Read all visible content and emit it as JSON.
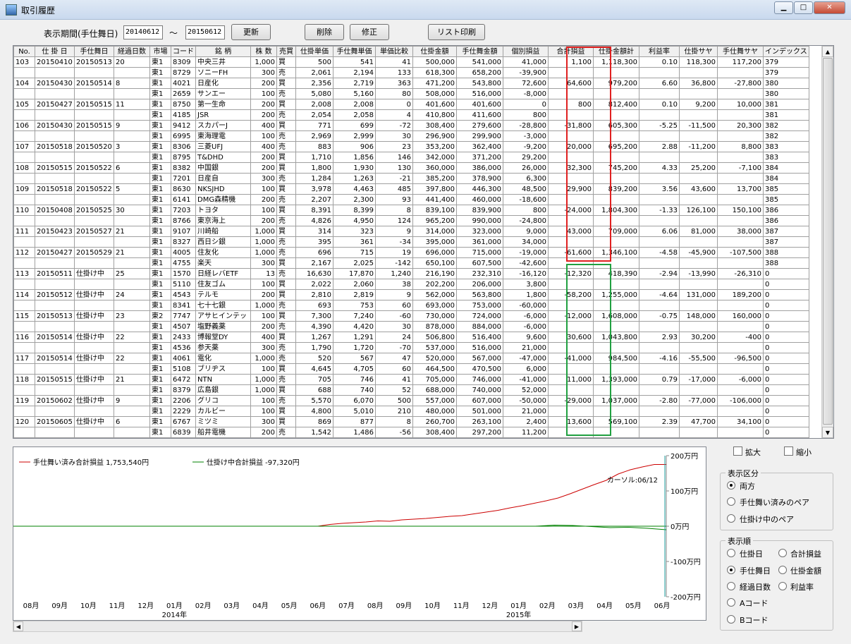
{
  "window": {
    "title": "取引履歴"
  },
  "toolbar": {
    "period_label": "表示期間(手仕舞日)",
    "date_from": "20140612",
    "tilde": "～",
    "date_to": "20150612",
    "refresh": "更新",
    "delete": "削除",
    "edit": "修正",
    "print": "リスト印刷"
  },
  "table": {
    "headers": [
      "No.",
      "仕 掛 日",
      "手仕舞日",
      "経過日数",
      "市場",
      "コード",
      "銘 柄",
      "株 数",
      "売買",
      "仕掛単価",
      "手仕舞単価",
      "単価比較",
      "仕掛金額",
      "手仕舞金額",
      "個別損益",
      "合計損益",
      "仕掛金額計",
      "利益率",
      "仕掛サヤ",
      "手仕舞サヤ",
      "インデックス"
    ],
    "rows": [
      [
        "103",
        "20150410",
        "20150513",
        "20",
        "東1",
        "8309",
        "中央三井",
        "1,000",
        "買",
        "500",
        "541",
        "41",
        "500,000",
        "541,000",
        "41,000",
        "1,100",
        "1,118,300",
        "0.10",
        "118,300",
        "117,200",
        "379"
      ],
      [
        "",
        "",
        "",
        "",
        "東1",
        "8729",
        "ソニーFH",
        "300",
        "売",
        "2,061",
        "2,194",
        "133",
        "618,300",
        "658,200",
        "-39,900",
        "",
        "",
        "",
        "",
        "",
        "379"
      ],
      [
        "104",
        "20150430",
        "20150514",
        "8",
        "東1",
        "4021",
        "日産化",
        "200",
        "買",
        "2,356",
        "2,719",
        "363",
        "471,200",
        "543,800",
        "72,600",
        "64,600",
        "979,200",
        "6.60",
        "36,800",
        "-27,800",
        "380"
      ],
      [
        "",
        "",
        "",
        "",
        "東1",
        "2659",
        "サンエー",
        "100",
        "売",
        "5,080",
        "5,160",
        "80",
        "508,000",
        "516,000",
        "-8,000",
        "",
        "",
        "",
        "",
        "",
        "380"
      ],
      [
        "105",
        "20150427",
        "20150515",
        "11",
        "東1",
        "8750",
        "第一生命",
        "200",
        "買",
        "2,008",
        "2,008",
        "0",
        "401,600",
        "401,600",
        "0",
        "800",
        "812,400",
        "0.10",
        "9,200",
        "10,000",
        "381"
      ],
      [
        "",
        "",
        "",
        "",
        "東1",
        "4185",
        "JSR",
        "200",
        "売",
        "2,054",
        "2,058",
        "4",
        "410,800",
        "411,600",
        "800",
        "",
        "",
        "",
        "",
        "",
        "381"
      ],
      [
        "106",
        "20150430",
        "20150515",
        "9",
        "東1",
        "9412",
        "スカパーJ",
        "400",
        "買",
        "771",
        "699",
        "-72",
        "308,400",
        "279,600",
        "-28,800",
        "-31,800",
        "605,300",
        "-5.25",
        "-11,500",
        "20,300",
        "382"
      ],
      [
        "",
        "",
        "",
        "",
        "東1",
        "6995",
        "東海理電",
        "100",
        "売",
        "2,969",
        "2,999",
        "30",
        "296,900",
        "299,900",
        "-3,000",
        "",
        "",
        "",
        "",
        "",
        "382"
      ],
      [
        "107",
        "20150518",
        "20150520",
        "3",
        "東1",
        "8306",
        "三菱UFJ",
        "400",
        "売",
        "883",
        "906",
        "23",
        "353,200",
        "362,400",
        "-9,200",
        "20,000",
        "695,200",
        "2.88",
        "-11,200",
        "8,800",
        "383"
      ],
      [
        "",
        "",
        "",
        "",
        "東1",
        "8795",
        "T&DHD",
        "200",
        "買",
        "1,710",
        "1,856",
        "146",
        "342,000",
        "371,200",
        "29,200",
        "",
        "",
        "",
        "",
        "",
        "383"
      ],
      [
        "108",
        "20150515",
        "20150522",
        "6",
        "東1",
        "8382",
        "中国銀",
        "200",
        "買",
        "1,800",
        "1,930",
        "130",
        "360,000",
        "386,000",
        "26,000",
        "32,300",
        "745,200",
        "4.33",
        "25,200",
        "-7,100",
        "384"
      ],
      [
        "",
        "",
        "",
        "",
        "東1",
        "7201",
        "日産自",
        "300",
        "売",
        "1,284",
        "1,263",
        "-21",
        "385,200",
        "378,900",
        "6,300",
        "",
        "",
        "",
        "",
        "",
        "384"
      ],
      [
        "109",
        "20150518",
        "20150522",
        "5",
        "東1",
        "8630",
        "NKSJHD",
        "100",
        "買",
        "3,978",
        "4,463",
        "485",
        "397,800",
        "446,300",
        "48,500",
        "29,900",
        "839,200",
        "3.56",
        "43,600",
        "13,700",
        "385"
      ],
      [
        "",
        "",
        "",
        "",
        "東1",
        "6141",
        "DMG森精機",
        "200",
        "売",
        "2,207",
        "2,300",
        "93",
        "441,400",
        "460,000",
        "-18,600",
        "",
        "",
        "",
        "",
        "",
        "385"
      ],
      [
        "110",
        "20150408",
        "20150525",
        "30",
        "東1",
        "7203",
        "トヨタ",
        "100",
        "買",
        "8,391",
        "8,399",
        "8",
        "839,100",
        "839,900",
        "800",
        "-24,000",
        "1,804,300",
        "-1.33",
        "126,100",
        "150,100",
        "386"
      ],
      [
        "",
        "",
        "",
        "",
        "東1",
        "8766",
        "東京海上",
        "200",
        "売",
        "4,826",
        "4,950",
        "124",
        "965,200",
        "990,000",
        "-24,800",
        "",
        "",
        "",
        "",
        "",
        "386"
      ],
      [
        "111",
        "20150423",
        "20150527",
        "21",
        "東1",
        "9107",
        "川崎船",
        "1,000",
        "買",
        "314",
        "323",
        "9",
        "314,000",
        "323,000",
        "9,000",
        "43,000",
        "709,000",
        "6.06",
        "81,000",
        "38,000",
        "387"
      ],
      [
        "",
        "",
        "",
        "",
        "東1",
        "8327",
        "西日シ銀",
        "1,000",
        "売",
        "395",
        "361",
        "-34",
        "395,000",
        "361,000",
        "34,000",
        "",
        "",
        "",
        "",
        "",
        "387"
      ],
      [
        "112",
        "20150427",
        "20150529",
        "21",
        "東1",
        "4005",
        "住友化",
        "1,000",
        "売",
        "696",
        "715",
        "19",
        "696,000",
        "715,000",
        "-19,000",
        "-61,600",
        "1,346,100",
        "-4.58",
        "-45,900",
        "-107,500",
        "388"
      ],
      [
        "",
        "",
        "",
        "",
        "東1",
        "4755",
        "楽天",
        "300",
        "買",
        "2,167",
        "2,025",
        "-142",
        "650,100",
        "607,500",
        "-42,600",
        "",
        "",
        "",
        "",
        "",
        "388"
      ],
      [
        "113",
        "20150511",
        "仕掛け中",
        "25",
        "東1",
        "1570",
        "日経レバETF",
        "13",
        "売",
        "16,630",
        "17,870",
        "1,240",
        "216,190",
        "232,310",
        "-16,120",
        "-12,320",
        "418,390",
        "-2.94",
        "-13,990",
        "-26,310",
        "0"
      ],
      [
        "",
        "",
        "",
        "",
        "東1",
        "5110",
        "住友ゴム",
        "100",
        "買",
        "2,022",
        "2,060",
        "38",
        "202,200",
        "206,000",
        "3,800",
        "",
        "",
        "",
        "",
        "",
        "0"
      ],
      [
        "114",
        "20150512",
        "仕掛け中",
        "24",
        "東1",
        "4543",
        "テルモ",
        "200",
        "買",
        "2,810",
        "2,819",
        "9",
        "562,000",
        "563,800",
        "1,800",
        "-58,200",
        "1,255,000",
        "-4.64",
        "131,000",
        "189,200",
        "0"
      ],
      [
        "",
        "",
        "",
        "",
        "東1",
        "8341",
        "七十七銀",
        "1,000",
        "売",
        "693",
        "753",
        "60",
        "693,000",
        "753,000",
        "-60,000",
        "",
        "",
        "",
        "",
        "",
        "0"
      ],
      [
        "115",
        "20150513",
        "仕掛け中",
        "23",
        "東2",
        "7747",
        "アサヒインテッ",
        "100",
        "買",
        "7,300",
        "7,240",
        "-60",
        "730,000",
        "724,000",
        "-6,000",
        "-12,000",
        "1,608,000",
        "-0.75",
        "148,000",
        "160,000",
        "0"
      ],
      [
        "",
        "",
        "",
        "",
        "東1",
        "4507",
        "塩野義薬",
        "200",
        "売",
        "4,390",
        "4,420",
        "30",
        "878,000",
        "884,000",
        "-6,000",
        "",
        "",
        "",
        "",
        "",
        "0"
      ],
      [
        "116",
        "20150514",
        "仕掛け中",
        "22",
        "東1",
        "2433",
        "博報堂DY",
        "400",
        "買",
        "1,267",
        "1,291",
        "24",
        "506,800",
        "516,400",
        "9,600",
        "30,600",
        "1,043,800",
        "2.93",
        "30,200",
        "-400",
        "0"
      ],
      [
        "",
        "",
        "",
        "",
        "東1",
        "4536",
        "参天薬",
        "300",
        "売",
        "1,790",
        "1,720",
        "-70",
        "537,000",
        "516,000",
        "21,000",
        "",
        "",
        "",
        "",
        "",
        "0"
      ],
      [
        "117",
        "20150514",
        "仕掛け中",
        "22",
        "東1",
        "4061",
        "電化",
        "1,000",
        "売",
        "520",
        "567",
        "47",
        "520,000",
        "567,000",
        "-47,000",
        "-41,000",
        "984,500",
        "-4.16",
        "-55,500",
        "-96,500",
        "0"
      ],
      [
        "",
        "",
        "",
        "",
        "東1",
        "5108",
        "ブリヂス",
        "100",
        "買",
        "4,645",
        "4,705",
        "60",
        "464,500",
        "470,500",
        "6,000",
        "",
        "",
        "",
        "",
        "",
        "0"
      ],
      [
        "118",
        "20150515",
        "仕掛け中",
        "21",
        "東1",
        "6472",
        "NTN",
        "1,000",
        "売",
        "705",
        "746",
        "41",
        "705,000",
        "746,000",
        "-41,000",
        "11,000",
        "1,393,000",
        "0.79",
        "-17,000",
        "-6,000",
        "0"
      ],
      [
        "",
        "",
        "",
        "",
        "東1",
        "8379",
        "広島銀",
        "1,000",
        "買",
        "688",
        "740",
        "52",
        "688,000",
        "740,000",
        "52,000",
        "",
        "",
        "",
        "",
        "",
        "0"
      ],
      [
        "119",
        "20150602",
        "仕掛け中",
        "9",
        "東1",
        "2206",
        "グリコ",
        "100",
        "売",
        "5,570",
        "6,070",
        "500",
        "557,000",
        "607,000",
        "-50,000",
        "-29,000",
        "1,037,000",
        "-2.80",
        "-77,000",
        "-106,000",
        "0"
      ],
      [
        "",
        "",
        "",
        "",
        "東1",
        "2229",
        "カルビー",
        "100",
        "買",
        "4,800",
        "5,010",
        "210",
        "480,000",
        "501,000",
        "21,000",
        "",
        "",
        "",
        "",
        "",
        "0"
      ],
      [
        "120",
        "20150605",
        "仕掛け中",
        "6",
        "東1",
        "6767",
        "ミツミ",
        "300",
        "買",
        "869",
        "877",
        "8",
        "260,700",
        "263,100",
        "2,400",
        "13,600",
        "569,100",
        "2.39",
        "47,700",
        "34,100",
        "0"
      ],
      [
        "",
        "",
        "",
        "",
        "東1",
        "6839",
        "船井電機",
        "200",
        "売",
        "1,542",
        "1,486",
        "-56",
        "308,400",
        "297,200",
        "11,200",
        "",
        "",
        "",
        "",
        "",
        "0"
      ]
    ]
  },
  "chart_data": {
    "type": "line",
    "legend": [
      "手仕舞い済み合計損益 1,753,540円",
      "仕掛け中合計損益 -97,320円"
    ],
    "colors": [
      "#cc0000",
      "#008000"
    ],
    "y_ticks": [
      "200万円",
      "100万円",
      "0万円",
      "-100万円",
      "-200万円"
    ],
    "ylim": [
      -200,
      200
    ],
    "x_ticks": [
      "08月",
      "09月",
      "10月",
      "11月",
      "12月",
      "01月",
      "02月",
      "03月",
      "04月",
      "05月",
      "06月",
      "07月",
      "08月",
      "09月",
      "10月",
      "11月",
      "12月",
      "01月",
      "02月",
      "03月",
      "04月",
      "05月",
      "06月"
    ],
    "year_labels": [
      "2014年",
      "2015年"
    ],
    "cursor_label": "カーソル:06/12",
    "series": [
      {
        "name": "手仕舞い済み合計損益 1,753,540円",
        "start_index": 10,
        "values": [
          0,
          5,
          8,
          10,
          12,
          15,
          14,
          18,
          20,
          22,
          25,
          28,
          30,
          35,
          40,
          45,
          52,
          58,
          65,
          72,
          80,
          92,
          105,
          118,
          130,
          148,
          160,
          168,
          175,
          175
        ]
      },
      {
        "name": "仕掛け中合計損益 -97,320円",
        "start_index": 0,
        "values": [
          0,
          0,
          0,
          0,
          0,
          0,
          0,
          0,
          0,
          0,
          0,
          0,
          0,
          0,
          0,
          0,
          0,
          0,
          0,
          0,
          0,
          0,
          0,
          0,
          0,
          0,
          0,
          0,
          3,
          2,
          -1,
          -4,
          -3,
          -6,
          -10
        ]
      }
    ]
  },
  "side": {
    "expand": "拡大",
    "shrink": "縮小",
    "display_group": "表示区分",
    "display_opts": [
      "両方",
      "手仕舞い済みのペア",
      "仕掛け中のペア"
    ],
    "order_group": "表示順",
    "order_opts": [
      "仕掛日",
      "合計損益",
      "手仕舞日",
      "仕掛金額",
      "経過日数",
      "利益率",
      "Aコード",
      "Bコード"
    ]
  }
}
